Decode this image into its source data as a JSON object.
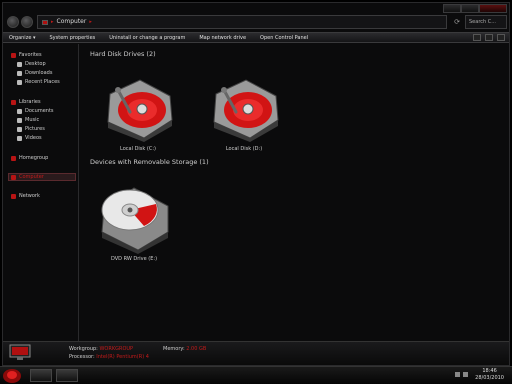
{
  "address": {
    "path": "Computer"
  },
  "search": {
    "placeholder": "Search C..."
  },
  "toolbar": {
    "items": [
      "Organize ▾",
      "System properties",
      "Uninstall or change a program",
      "Map network drive",
      "Open Control Panel"
    ]
  },
  "nav": {
    "favorites": "Favorites",
    "desktop": "Desktop",
    "downloads": "Downloads",
    "recent": "Recent Places",
    "libraries": "Libraries",
    "documents": "Documents",
    "music": "Music",
    "pictures": "Pictures",
    "videos": "Videos",
    "homegroup": "Homegroup",
    "computer": "Computer",
    "network": "Network"
  },
  "groups": {
    "hdd_title": "Hard Disk Drives (2)",
    "removable_title": "Devices with Removable Storage (1)"
  },
  "drives": {
    "c": "Local Disk (C:)",
    "d": "Local Disk (D:)",
    "e": "DVD RW Drive (E:)"
  },
  "details": {
    "workgroup_label": "Workgroup:",
    "workgroup_value": "WORKGROUP",
    "memory_label": "Memory:",
    "memory_value": "2.00 GB",
    "processor_label": "Processor:",
    "processor_value": "Intel(R) Pentium(R) 4"
  },
  "clock": {
    "time": "18:46",
    "date": "28/03/2010"
  },
  "colors": {
    "accent": "#c41a1a",
    "background": "#0b0b0c"
  }
}
